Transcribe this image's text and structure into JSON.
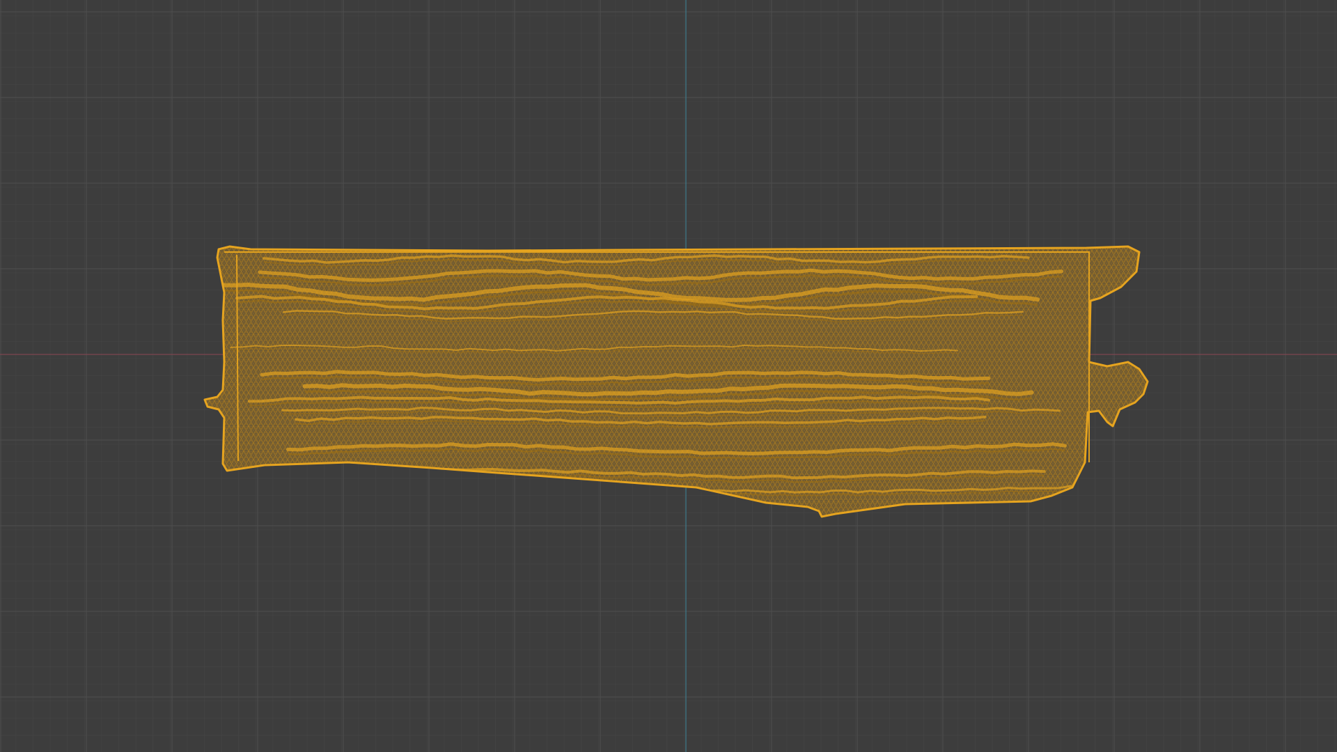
{
  "viewport": {
    "view": "orthographic-front",
    "shading": "wireframe",
    "object_selected": true,
    "show_grid": true,
    "show_axes": [
      "x",
      "z"
    ]
  },
  "colors": {
    "background": "#3d3d3d",
    "grid_minor": "#474747",
    "grid_major": "#4f4f4f",
    "axis_x": "#8a4a52",
    "axis_z": "#3f7e92",
    "wire_selected": "#e2a21f",
    "wire_dark": "#9c6e12",
    "mesh_fill": "#7a6232"
  }
}
